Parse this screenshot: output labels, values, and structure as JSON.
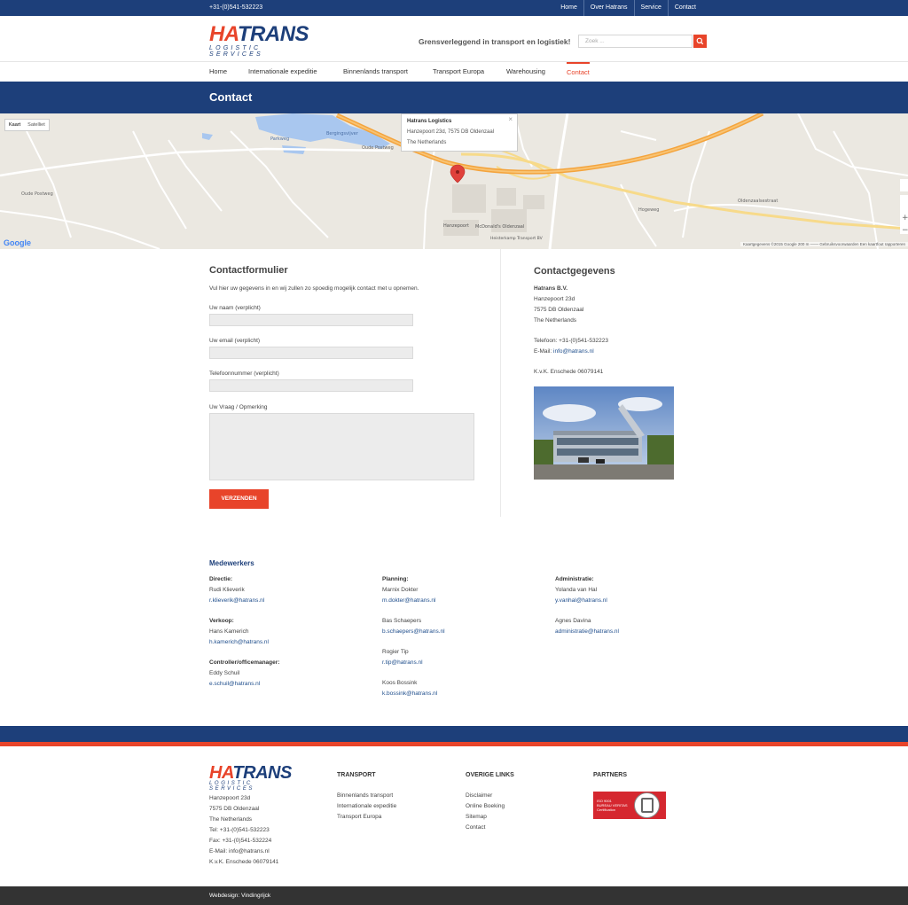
{
  "topbar": {
    "phone": "+31-(0)541-532223",
    "nav": [
      "Home",
      "Over Hatrans",
      "Service",
      "Contact"
    ]
  },
  "header": {
    "logo_ha": "HA",
    "logo_trans": "TRANS",
    "logo_sub": "LOGISTIC SERVICES",
    "tagline": "Grensverleggend in transport en logistiek!",
    "search_placeholder": "Zoek ..."
  },
  "mainnav": [
    "Home",
    "Internationale expeditie",
    "Binnenlands transport",
    "Transport Europa",
    "Warehousing",
    "Contact"
  ],
  "page_title": "Contact",
  "map": {
    "type_buttons": [
      "Kaart",
      "Satelliet"
    ],
    "info_title": "Hatrans Logistics",
    "info_line1": "Hanzepoort 23d, 7575 DB Oldenzaal",
    "info_line2": "The Netherlands",
    "close": "×",
    "google": "Google",
    "footer_text": "Kaartgegevens ©2015 Google   200 m ───   Gebruiksvoorwaarden   Een kaartfout rapporteren",
    "labels": {
      "oude_postweg": "Oude Postweg",
      "hanzepoort": "Hanzepoort",
      "mcdonalds": "McDonald's Oldenzaal",
      "heisterkamp": "Heisterkamp Transport BV",
      "oldenzaalsestraat": "Oldenzaalsestraat",
      "berginsvijver": "Bergingsvijver",
      "parkweg": "Parkweg",
      "hogeweg": "Hogeweg"
    }
  },
  "form": {
    "title": "Contactformulier",
    "intro": "Vul hier uw gegevens in en wij zullen zo spoedig mogelijk contact met u opnemen.",
    "name_label": "Uw naam (verplicht)",
    "email_label": "Uw email (verplicht)",
    "phone_label": "Telefoonnummer (verplicht)",
    "message_label": "Uw Vraag / Opmerking",
    "submit": "VERZENDEN"
  },
  "contact": {
    "title": "Contactgegevens",
    "company": "Hatrans B.V.",
    "street": "Hanzepoort 23d",
    "city": "7575 DB Oldenzaal",
    "country": "The Netherlands",
    "phone": "Telefoon: +31-(0)541-532223",
    "email_prefix": "E-Mail: ",
    "email": "info@hatrans.nl",
    "kvk": "K.v.K. Enschede 06079141"
  },
  "medewerkers": {
    "title": "Medewerkers",
    "col1": [
      {
        "role": "Directie:",
        "name": "Rudi Klieverik",
        "email": "r.klieverik@hatrans.nl"
      },
      {
        "role": "Verkoop:",
        "name": "Hans Kamerich",
        "email": "h.kamerich@hatrans.nl"
      },
      {
        "role": "Controller/officemanager:",
        "name": "Eddy Schuil",
        "email": "e.schuil@hatrans.nl"
      }
    ],
    "col2": {
      "role": "Planning:",
      "people": [
        {
          "name": "Marnix Dokter",
          "email": "m.dokter@hatrans.nl"
        },
        {
          "name": "Bas Schaepers",
          "email": "b.schaepers@hatrans.nl"
        },
        {
          "name": "Rogier Tip",
          "email": "r.tip@hatrans.nl"
        },
        {
          "name": "Koos Bossink",
          "email": "k.bossink@hatrans.nl"
        }
      ]
    },
    "col3": {
      "role": "Administratie:",
      "people": [
        {
          "name": "Yolanda van Hal",
          "email": "y.vanhal@hatrans.nl"
        },
        {
          "name": "Agnes Davina",
          "email": "administratie@hatrans.nl"
        }
      ]
    }
  },
  "footer": {
    "address": [
      "Hanzepoort 23d",
      "7575 DB Oldenzaal",
      "The Netherlands",
      "Tel: +31-(0)541-532223",
      "Fax: +31-(0)541-532224",
      "E-Mail: info@hatrans.nl",
      "K.v.K. Enschede 06079141"
    ],
    "transport_title": "TRANSPORT",
    "transport_links": [
      "Binnenlands transport",
      "Internationale expeditie",
      "Transport Europa"
    ],
    "other_title": "OVERIGE LINKS",
    "other_links": [
      "Disclaimer",
      "Online Boeking",
      "Sitemap",
      "Contact"
    ],
    "partners_title": "PARTNERS",
    "badge_iso": "ISO 9001",
    "badge_bv": "BUREAU VERITAS",
    "badge_cert": "Certification",
    "webdesign": "Webdesign: Vindingrijck"
  },
  "colors": {
    "brand_blue": "#1d3f7a",
    "brand_orange": "#e8442a"
  }
}
